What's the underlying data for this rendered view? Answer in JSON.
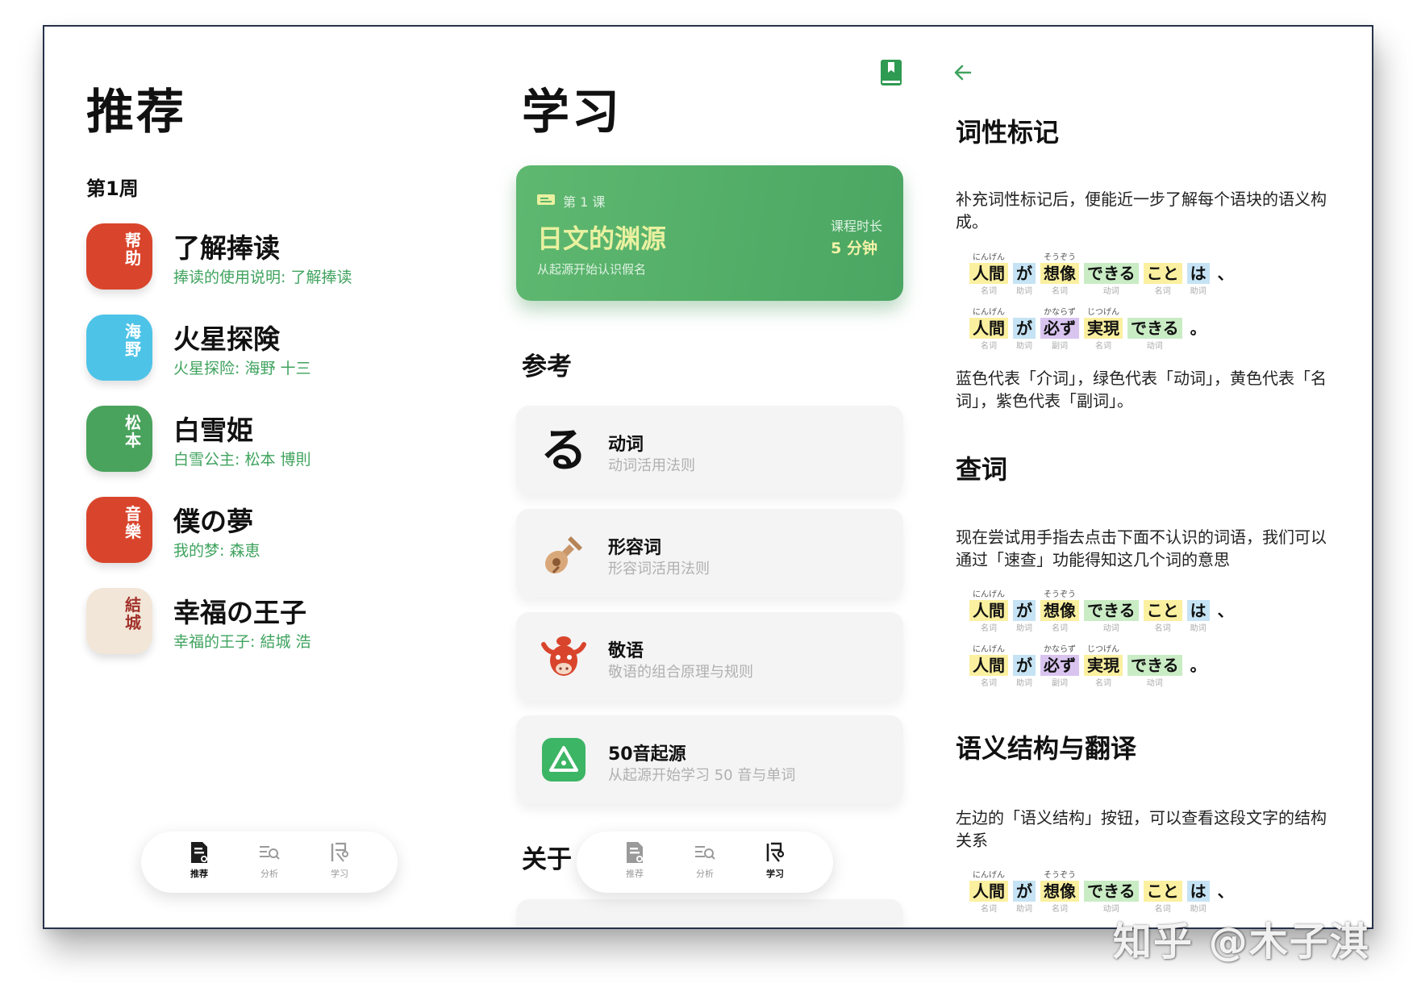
{
  "recommend": {
    "title": "推荐",
    "week": "第1周",
    "books": [
      {
        "badge": "帮助",
        "title": "了解捧读",
        "subtitle": "捧读的使用说明: 了解捧读",
        "color": "#d9452c"
      },
      {
        "badge": "海野",
        "title": "火星探険",
        "subtitle": "火星探险: 海野 十三",
        "color": "#4ec3e8"
      },
      {
        "badge": "松本",
        "title": "白雪姫",
        "subtitle": "白雪公主: 松本 博則",
        "color": "#49a35c"
      },
      {
        "badge": "音樂",
        "title": "僕の夢",
        "subtitle": "我的梦: 森恵",
        "color": "#d9452c"
      },
      {
        "badge": "結城",
        "title": "幸福の王子",
        "subtitle": "幸福的王子: 結城 浩",
        "color": "#f2e6d8"
      }
    ]
  },
  "tabs": [
    "推荐",
    "分析",
    "学习"
  ],
  "learn": {
    "title": "学习",
    "course": {
      "lesson": "第 1 课",
      "title": "日文的渊源",
      "subtitle": "从起源开始认识假名",
      "duration_label": "课程时长",
      "duration_value": "5 分钟"
    },
    "reference_title": "参考",
    "references": [
      {
        "icon": "ru-glyph-icon",
        "glyph": "る",
        "title": "动词",
        "subtitle": "动词活用法则"
      },
      {
        "icon": "guitar-icon",
        "title": "形容词",
        "subtitle": "形容词活用法则"
      },
      {
        "icon": "bull-mascot-icon",
        "title": "敬语",
        "subtitle": "敬语的组合原理与规则"
      },
      {
        "icon": "triangle-badge-icon",
        "title": "50音起源",
        "subtitle": "从起源开始学习 50 音与单词"
      }
    ],
    "about_title": "关于"
  },
  "guide": {
    "pos_title": "词性标记",
    "pos_desc": "补充词性标记后，便能近一步了解每个语块的语义构成。",
    "color_desc": "蓝色代表「介词」，绿色代表「动词」，黄色代表「名词」，紫色代表「副词」。",
    "lookup_title": "查词",
    "lookup_desc": "现在尝试用手指去点击下面不认识的词语，我们可以通过「速查」功能得知这几个词的意思",
    "semantic_title": "语义结构与翻译",
    "semantic_desc": "左边的「语义结构」按钮，可以查看这段文字的结构关系",
    "sentence1": [
      {
        "ruby": "にんげん",
        "word": "人間",
        "pos": "名词",
        "color": "y"
      },
      {
        "ruby": "",
        "word": "が",
        "pos": "助词",
        "color": "b"
      },
      {
        "ruby": "そうぞう",
        "word": "想像",
        "pos": "名词",
        "color": "y"
      },
      {
        "ruby": "",
        "word": "できる",
        "pos": "动词",
        "color": "g"
      },
      {
        "ruby": "",
        "word": "こと",
        "pos": "名词",
        "color": "y"
      },
      {
        "ruby": "",
        "word": "は",
        "pos": "助词",
        "color": "b"
      },
      {
        "ruby": "",
        "word": "、",
        "pos": "",
        "color": "n"
      }
    ],
    "sentence2": [
      {
        "ruby": "にんげん",
        "word": "人間",
        "pos": "名词",
        "color": "y"
      },
      {
        "ruby": "",
        "word": "が",
        "pos": "助词",
        "color": "b"
      },
      {
        "ruby": "かならず",
        "word": "必ず",
        "pos": "副词",
        "color": "v"
      },
      {
        "ruby": "じつげん",
        "word": "実現",
        "pos": "名词",
        "color": "y"
      },
      {
        "ruby": "",
        "word": "できる",
        "pos": "动词",
        "color": "g"
      },
      {
        "ruby": "",
        "word": "。",
        "pos": "",
        "color": "n"
      }
    ]
  },
  "watermark": "知乎 @木子淇"
}
